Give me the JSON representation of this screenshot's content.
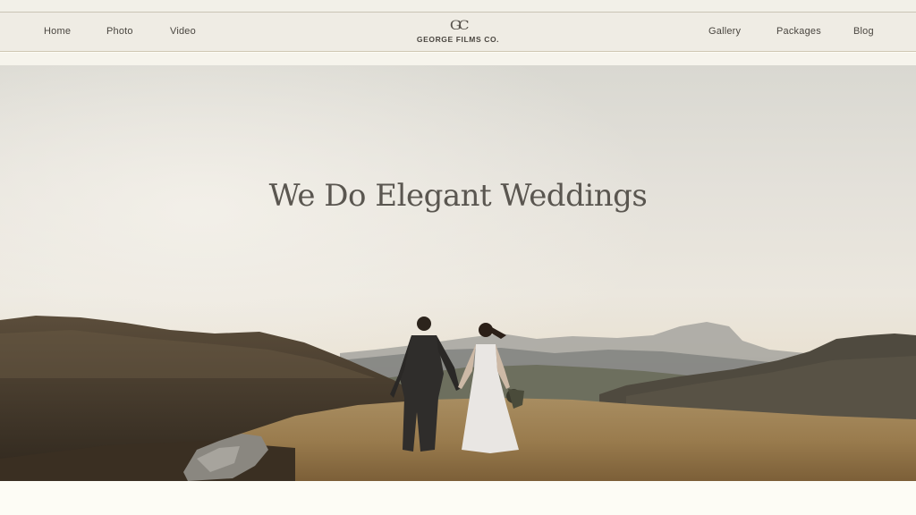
{
  "nav": {
    "left_items": [
      {
        "label": "Home"
      },
      {
        "label": "Photo"
      },
      {
        "label": "Video"
      }
    ],
    "right_items": [
      {
        "label": "Gallery"
      },
      {
        "label": "Packages"
      },
      {
        "label": "Blog"
      }
    ],
    "logo": {
      "monogram": "GC",
      "name": "GEORGE FILMS CO."
    }
  },
  "hero": {
    "title": "We Do Elegant Weddings",
    "image_subject": "wedding-couple-walking-hills"
  },
  "colors": {
    "nav_background": "#efece4",
    "page_background": "#fdfcf5",
    "text": "#4a4640",
    "hero_title": "#5a5650"
  }
}
